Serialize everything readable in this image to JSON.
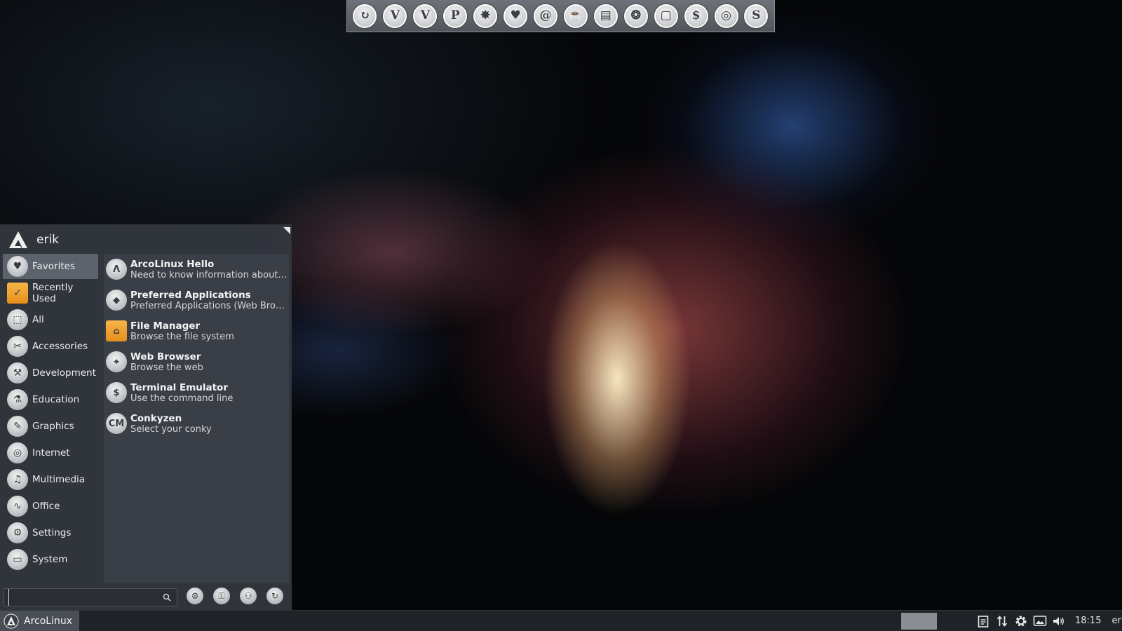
{
  "dock": {
    "launchers": [
      {
        "name": "firefox",
        "glyph": "↻"
      },
      {
        "name": "vivaldi",
        "glyph": "V"
      },
      {
        "name": "vivaldi-snapshot",
        "glyph": "V"
      },
      {
        "name": "pamac",
        "glyph": "P"
      },
      {
        "name": "packages",
        "glyph": "✸"
      },
      {
        "name": "ark",
        "glyph": "♥"
      },
      {
        "name": "spiral",
        "glyph": "@"
      },
      {
        "name": "teapot",
        "glyph": "☕"
      },
      {
        "name": "files",
        "glyph": "▤"
      },
      {
        "name": "aperture",
        "glyph": "❂"
      },
      {
        "name": "window",
        "glyph": "▢"
      },
      {
        "name": "terminal",
        "glyph": "$"
      },
      {
        "name": "screenshot",
        "glyph": "◎"
      },
      {
        "name": "s-app",
        "glyph": "S"
      }
    ]
  },
  "menu": {
    "user": "erik",
    "categories": [
      {
        "label": "Favorites",
        "icon": "heart-icon",
        "glyph": "♥",
        "active": true
      },
      {
        "label": "Recently Used",
        "icon": "recently-used-icon",
        "glyph": "✓",
        "folder": true
      },
      {
        "label": "All",
        "icon": "grid-icon",
        "glyph": "⬚"
      },
      {
        "label": "Accessories",
        "icon": "accessories-icon",
        "glyph": "✂"
      },
      {
        "label": "Development",
        "icon": "development-icon",
        "glyph": "⚒"
      },
      {
        "label": "Education",
        "icon": "flask-icon",
        "glyph": "⚗"
      },
      {
        "label": "Graphics",
        "icon": "palette-icon",
        "glyph": "✎"
      },
      {
        "label": "Internet",
        "icon": "globe-icon",
        "glyph": "◎"
      },
      {
        "label": "Multimedia",
        "icon": "multimedia-icon",
        "glyph": "♫"
      },
      {
        "label": "Office",
        "icon": "chart-icon",
        "glyph": "∿"
      },
      {
        "label": "Settings",
        "icon": "gear-icon",
        "glyph": "⚙"
      },
      {
        "label": "System",
        "icon": "system-icon",
        "glyph": "▭"
      }
    ],
    "apps": [
      {
        "name": "ArcoLinux Hello",
        "desc": "Need to know information about ArcoLinux",
        "icon": "arcolinux-icon",
        "glyph": "Λ"
      },
      {
        "name": "Preferred Applications",
        "desc": "Preferred Applications (Web Browser, Mail Reader and Terminal Emulator)",
        "icon": "diamond-icon",
        "glyph": "◆"
      },
      {
        "name": "File Manager",
        "desc": "Browse the file system",
        "icon": "folder-icon",
        "glyph": "⌂",
        "folder": true
      },
      {
        "name": "Web Browser",
        "desc": "Browse the web",
        "icon": "compass-icon",
        "glyph": "⌖"
      },
      {
        "name": "Terminal Emulator",
        "desc": "Use the command line",
        "icon": "terminal-icon",
        "glyph": "$"
      },
      {
        "name": "Conkyzen",
        "desc": "Select your conky",
        "icon": "conky-icon",
        "glyph": "CM"
      }
    ],
    "search": {
      "value": "",
      "placeholder": ""
    },
    "actions": [
      {
        "name": "settings-manager-button",
        "glyph": "⚙"
      },
      {
        "name": "lock-screen-button",
        "glyph": "⚿"
      },
      {
        "name": "switch-user-button",
        "glyph": "⚇"
      },
      {
        "name": "logout-button",
        "glyph": "↻"
      }
    ]
  },
  "panel": {
    "start_label": "ArcoLinux",
    "clock": "18:15",
    "user": "erik"
  }
}
